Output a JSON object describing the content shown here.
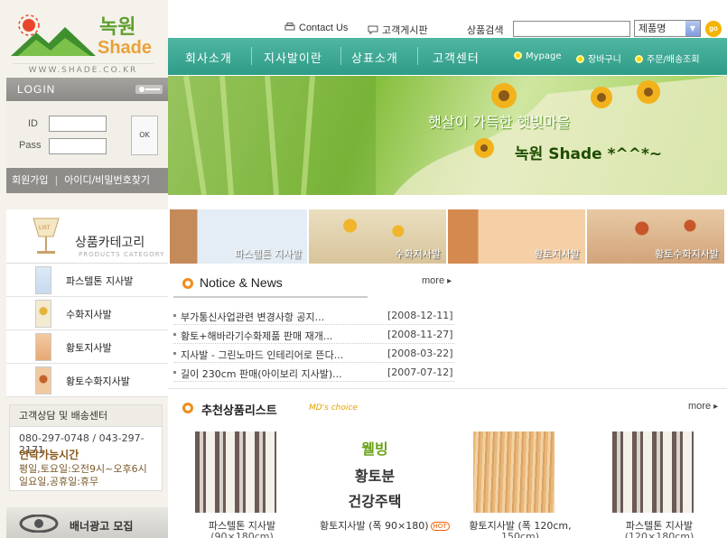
{
  "brand": {
    "name_ko": "녹원",
    "name_en": "Shade",
    "url": "WWW.SHADE.CO.KR"
  },
  "login": {
    "title": "LOGIN",
    "id_label": "ID",
    "pass_label": "Pass",
    "ok_label": "OK",
    "join_label": "회원가입",
    "find_label": "아이디/비밀번호찾기"
  },
  "utility": {
    "contact_label": "Contact Us",
    "board_label": "고객게시판",
    "search_label": "상품검색",
    "search_value": "",
    "select_value": "제품명",
    "go_label": "go"
  },
  "nav": {
    "items": [
      {
        "label": "회사소개"
      },
      {
        "label": "지사발이란"
      },
      {
        "label": "상표소개"
      },
      {
        "label": "고객센터"
      }
    ],
    "sub_links": [
      {
        "label": "Mypage"
      },
      {
        "label": "장바구니"
      },
      {
        "label": "주문/배송조회"
      }
    ]
  },
  "hero": {
    "slogan": "햇살이 가득한 햇빛마을",
    "brand_line": "녹원 Shade *^^*~"
  },
  "categories": {
    "title": "상품카테고리",
    "subtitle": "PRODUCTS CATEGORY",
    "lamp_text": "LIST",
    "items": [
      {
        "label": "파스텔톤 지사발"
      },
      {
        "label": "수화지사발"
      },
      {
        "label": "황토지사발"
      },
      {
        "label": "황토수화지사발"
      }
    ]
  },
  "category_banners": [
    {
      "label": "파스텔톤 지사발"
    },
    {
      "label": "수화지사발"
    },
    {
      "label": "황토지사발"
    },
    {
      "label": "황토수화지사발"
    }
  ],
  "customer_service": {
    "title": "고객상담 및 배송센터",
    "phone": "080-297-0748 / 043-297-2171",
    "hours_title": "연락가능시간",
    "hours_line1": "평일,토요일:오전9시~오후6시",
    "hours_line2": "일요일,공휴일:휴무"
  },
  "banner_ad": {
    "label": "배너광고 모집"
  },
  "notice": {
    "title": "Notice & News",
    "more_label": "more",
    "rows": [
      {
        "title": "부가통신사업관련 변경사항 공지...",
        "date": "[2008-12-11]"
      },
      {
        "title": "황토+해바라기수화제품 판매 재개...",
        "date": "[2008-11-27]"
      },
      {
        "title": "지사발 - 그린노마드 인테리어로 뜬다...",
        "date": "[2008-03-22]"
      },
      {
        "title": "길이 230cm 판매(아이보리 지사발)...",
        "date": "[2007-07-12]"
      }
    ]
  },
  "recommended": {
    "title": "추천상품리스트",
    "subtitle": "MD's choice",
    "more_label": "more",
    "products": [
      {
        "name": "파스텔톤 지사발",
        "tag": "",
        "price": "(90×180cm)"
      },
      {
        "name": "황토지사발 (폭 90×180)",
        "tag": "HOT",
        "price": ""
      },
      {
        "name": "황토지사발 (폭 120cm,",
        "tag": "",
        "price": "150cm)"
      },
      {
        "name": "파스텔톤 지사발",
        "tag": "",
        "price": "(120×180cm)"
      }
    ],
    "text_image": {
      "line1": "웰빙",
      "line2": "황토분",
      "line3": "건강주택"
    }
  },
  "colors": {
    "nav_green": "#36a28e",
    "accent_orange": "#f08c1e",
    "brand_green": "#5f9f2f",
    "brand_gold": "#e8a23a"
  }
}
